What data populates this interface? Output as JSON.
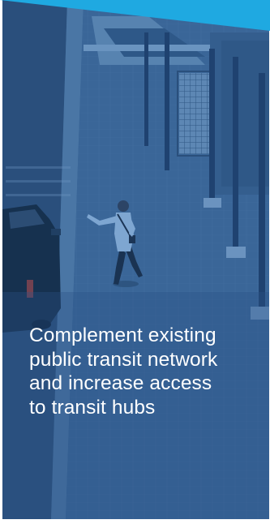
{
  "slide": {
    "headline_lines": [
      "Complement existing",
      "public transit network",
      "and increase access",
      "to transit hubs"
    ]
  },
  "colors": {
    "accent": "#1fa9e1",
    "overlay": "#2f5a8c",
    "text": "#ffffff"
  },
  "icons": {
    "photo": "transit-station-photo"
  }
}
